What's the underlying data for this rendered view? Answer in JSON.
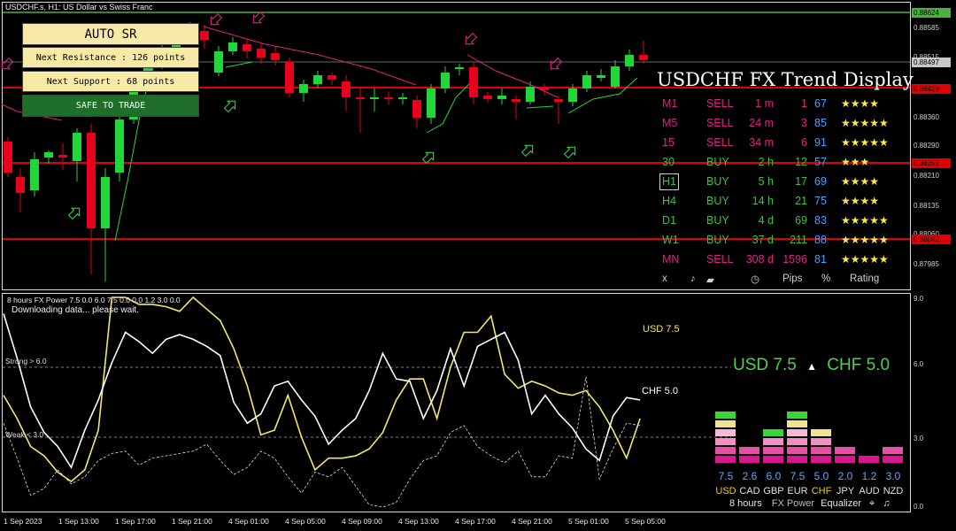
{
  "symbol_title": "USDCHF.s, H1:  US Dollar vs Swiss Franc",
  "auto_sr": {
    "title": "AUTO SR",
    "next_resistance": "Next Resistance : 126 points",
    "next_support": "Next Support : 68 points",
    "status": "SAFE TO TRADE"
  },
  "price_axis": {
    "labels": [
      "0.88585",
      "0.88515",
      "0.88360",
      "0.88290",
      "0.88210",
      "0.88135",
      "0.88060",
      "0.87985"
    ],
    "tags": [
      {
        "value": "0.88624",
        "color": "#4caf3f",
        "text_color": "#000000"
      },
      {
        "value": "0.88497",
        "color": "#c8c8c8",
        "text_color": "#000000"
      },
      {
        "value": "0.88429",
        "color": "#e00000",
        "text_color": "#000000"
      },
      {
        "value": "0.88252",
        "color": "#e00000",
        "text_color": "#000000"
      },
      {
        "value": "0.88042",
        "color": "#e00000",
        "text_color": "#000000"
      }
    ]
  },
  "trend_display": {
    "title": "USDCHF FX Trend Display",
    "rows": [
      {
        "tf": "M1",
        "signal": "SELL",
        "age": "1 m",
        "pips": "1",
        "pct": "67",
        "stars": "★★★★",
        "color": "#e0208a",
        "selected": false
      },
      {
        "tf": "M5",
        "signal": "SELL",
        "age": "24 m",
        "pips": "3",
        "pct": "85",
        "stars": "★★★★★",
        "color": "#e0208a",
        "selected": false
      },
      {
        "tf": "15",
        "signal": "SELL",
        "age": "34 m",
        "pips": "6",
        "pct": "91",
        "stars": "★★★★★",
        "color": "#e0208a",
        "selected": false
      },
      {
        "tf": "30",
        "signal": "BUY",
        "age": "2 h",
        "pips": "12",
        "pct": "57",
        "stars": "★★★",
        "color": "#3fbf3f",
        "selected": false
      },
      {
        "tf": "H1",
        "signal": "BUY",
        "age": "5 h",
        "pips": "17",
        "pct": "69",
        "stars": "★★★★",
        "color": "#3fbf3f",
        "selected": true
      },
      {
        "tf": "H4",
        "signal": "BUY",
        "age": "14 h",
        "pips": "21",
        "pct": "75",
        "stars": "★★★★",
        "color": "#3fbf3f",
        "selected": false
      },
      {
        "tf": "D1",
        "signal": "BUY",
        "age": "4 d",
        "pips": "69",
        "pct": "83",
        "stars": "★★★★★",
        "color": "#3fbf3f",
        "selected": false
      },
      {
        "tf": "W1",
        "signal": "BUY",
        "age": "37 d",
        "pips": "211",
        "pct": "88",
        "stars": "★★★★★",
        "color": "#3fbf3f",
        "selected": false
      },
      {
        "tf": "MN",
        "signal": "SELL",
        "age": "308 d",
        "pips": "1596",
        "pct": "81",
        "stars": "★★★★★",
        "color": "#e0208a",
        "selected": false
      }
    ],
    "footer": {
      "close": "x",
      "pips": "Pips",
      "pct": "%",
      "rating": "Rating"
    }
  },
  "power_panel": {
    "title": "8 hours FX Power 7.5 0.0 6.0 7.5 0.0 0.0 1.2 3.0 0.0",
    "status": "Downloading data... please wait.",
    "strong_label": "Strong > 6.0",
    "weak_label": "Weak < 3.0",
    "axis": [
      "9.0",
      "6.0",
      "3.0",
      "0.0"
    ],
    "usd_label": "USD 7.5",
    "chf_label": "CHF 5.0",
    "headline_left": "USD 7.5",
    "headline_sep": "▲",
    "headline_right": "CHF 5.0"
  },
  "equalizer": {
    "currencies": [
      {
        "name": "USD",
        "value": "7.5",
        "bars": 6,
        "active": true
      },
      {
        "name": "CAD",
        "value": "2.6",
        "bars": 2,
        "active": false
      },
      {
        "name": "GBP",
        "value": "6.0",
        "bars": 4,
        "active": false
      },
      {
        "name": "EUR",
        "value": "7.5",
        "bars": 6,
        "active": false
      },
      {
        "name": "CHF",
        "value": "5.0",
        "bars": 4,
        "active": true
      },
      {
        "name": "JPY",
        "value": "2.0",
        "bars": 2,
        "active": false
      },
      {
        "name": "AUD",
        "value": "1.2",
        "bars": 1,
        "active": false
      },
      {
        "name": "NZD",
        "value": "3.0",
        "bars": 2,
        "active": false
      }
    ],
    "footer": {
      "period": "8 hours",
      "brand": "FX Power",
      "mode": "Equalizer",
      "target": "⌖",
      "music": "♫"
    }
  },
  "time_axis": [
    "1 Sep 2023",
    "1 Sep 13:00",
    "1 Sep 17:00",
    "1 Sep 21:00",
    "4 Sep 01:00",
    "4 Sep 05:00",
    "4 Sep 09:00",
    "4 Sep 13:00",
    "4 Sep 17:00",
    "4 Sep 21:00",
    "5 Sep 01:00",
    "5 Sep 05:00"
  ]
}
